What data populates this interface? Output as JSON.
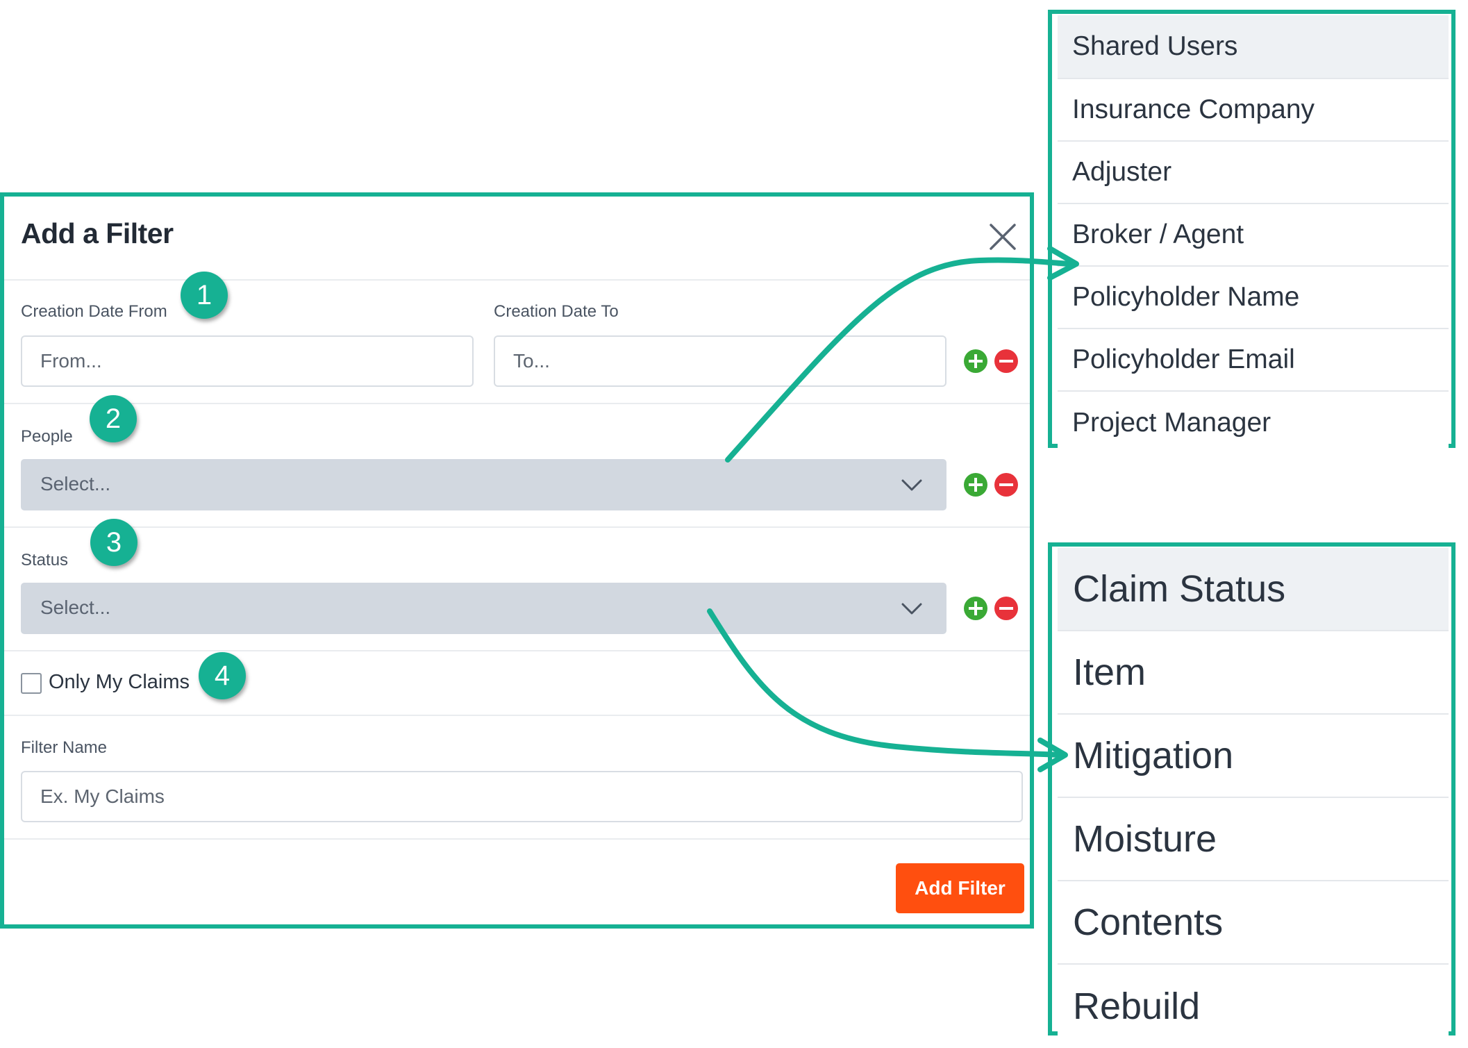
{
  "colors": {
    "accent_frame": "#16b193",
    "primary_button": "#ff4f0f",
    "add_icon": "#3aa935",
    "remove_icon": "#e8323a",
    "select_background": "#d2d8e0"
  },
  "dialog": {
    "title": "Add a Filter",
    "close_icon": "close-icon",
    "creation_date": {
      "from_label": "Creation Date From",
      "from_placeholder": "From...",
      "to_label": "Creation Date To",
      "to_placeholder": "To..."
    },
    "people": {
      "label": "People",
      "placeholder": "Select..."
    },
    "status": {
      "label": "Status",
      "placeholder": "Select..."
    },
    "only_my_claims": {
      "label": "Only My Claims",
      "checked": false
    },
    "filter_name": {
      "label": "Filter Name",
      "placeholder": "Ex. My Claims"
    },
    "submit_label": "Add Filter",
    "row_icons": [
      "plus-circle-icon",
      "minus-circle-icon"
    ]
  },
  "steps": [
    "1",
    "2",
    "3",
    "4"
  ],
  "people_options": [
    "Shared Users",
    "Insurance Company",
    "Adjuster",
    "Broker / Agent",
    "Policyholder Name",
    "Policyholder Email",
    "Project Manager"
  ],
  "status_options": [
    "Claim Status",
    "Item",
    "Mitigation",
    "Moisture",
    "Contents",
    "Rebuild"
  ]
}
